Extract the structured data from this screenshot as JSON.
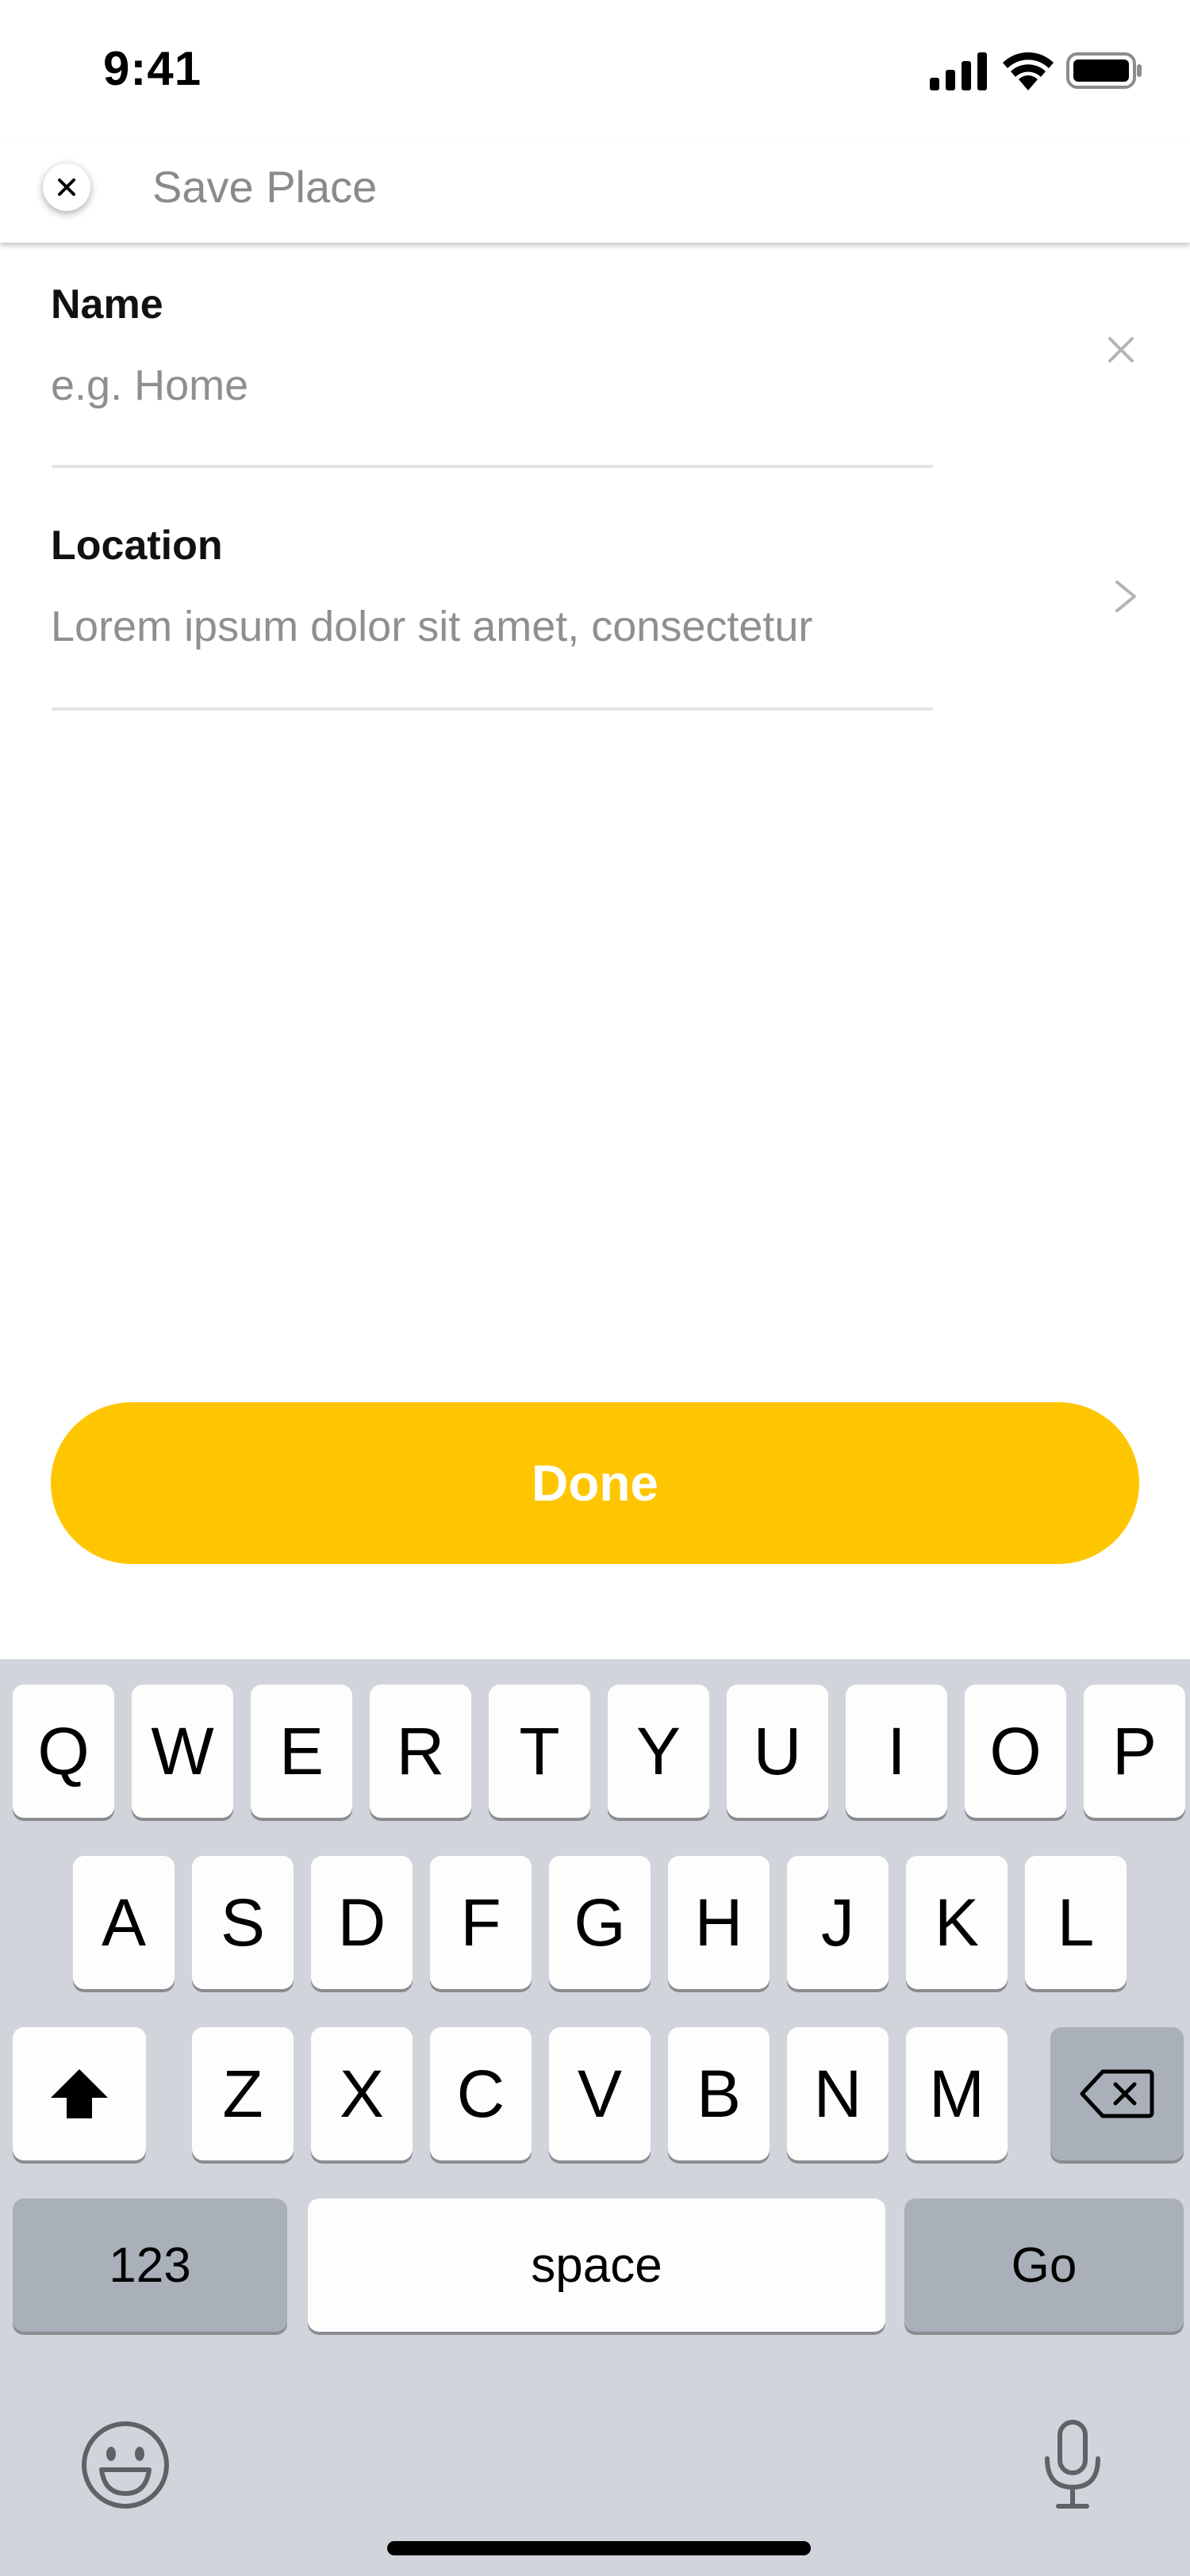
{
  "status_bar": {
    "time": "9:41"
  },
  "header": {
    "title": "Save Place",
    "close_icon": "close-icon"
  },
  "form": {
    "name": {
      "label": "Name",
      "placeholder": "e.g. Home",
      "value": ""
    },
    "location": {
      "label": "Location",
      "placeholder": "Lorem ipsum dolor sit amet, consectetur",
      "value": ""
    }
  },
  "done_button": {
    "label": "Done",
    "color": "#FEC600"
  },
  "keyboard": {
    "row1": [
      "Q",
      "W",
      "E",
      "R",
      "T",
      "Y",
      "U",
      "I",
      "O",
      "P"
    ],
    "row2": [
      "A",
      "S",
      "D",
      "F",
      "G",
      "H",
      "J",
      "K",
      "L"
    ],
    "row3": [
      "Z",
      "X",
      "C",
      "V",
      "B",
      "N",
      "M"
    ],
    "numbers_label": "123",
    "space_label": "space",
    "go_label": "Go"
  }
}
